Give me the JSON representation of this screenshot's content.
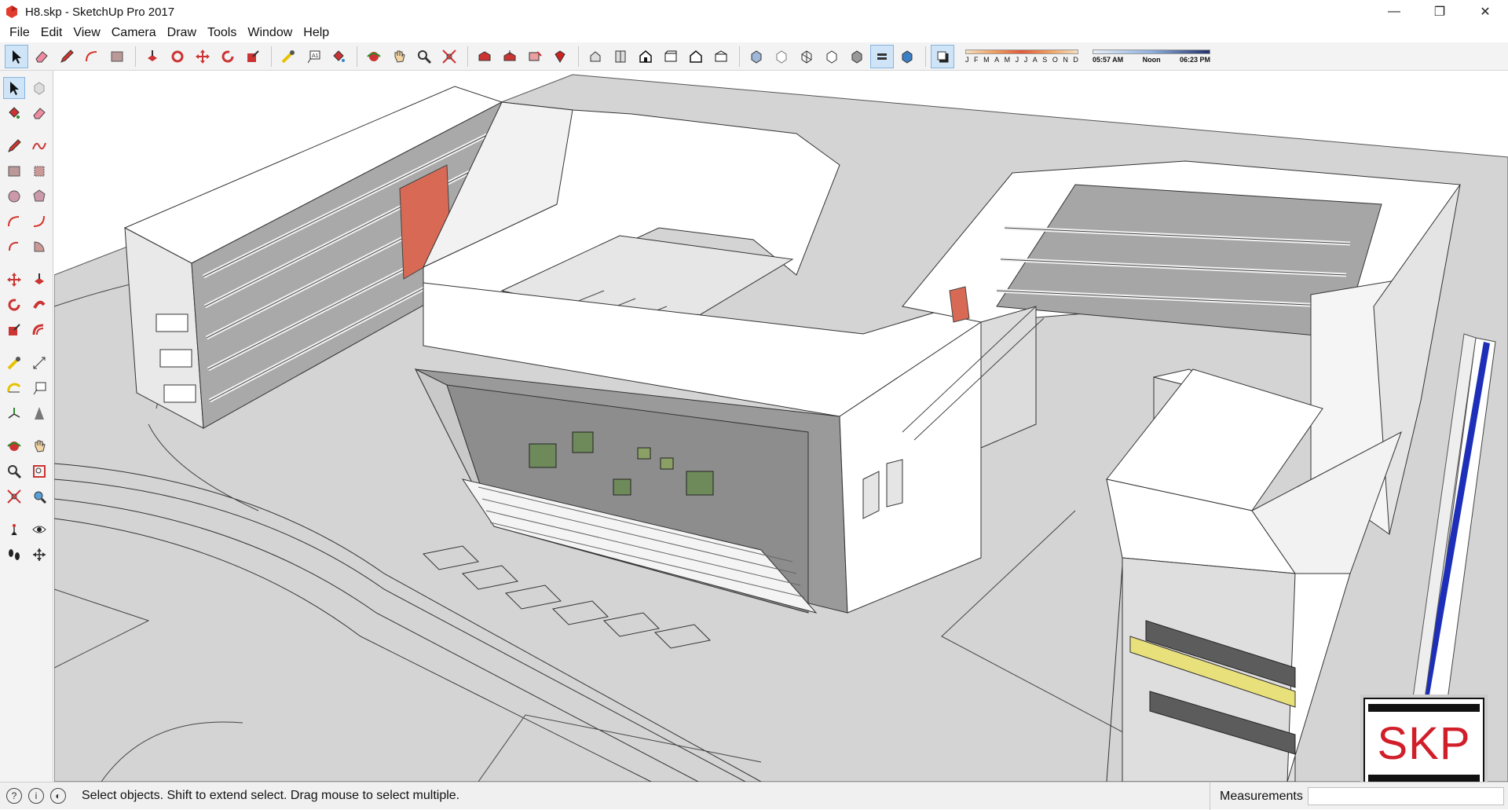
{
  "window": {
    "title": "H8.skp - SketchUp Pro 2017",
    "minimize_glyph": "—",
    "restore_glyph": "❐",
    "close_glyph": "✕"
  },
  "menu": [
    "File",
    "Edit",
    "View",
    "Camera",
    "Draw",
    "Tools",
    "Window",
    "Help"
  ],
  "shadows": {
    "months": [
      "J",
      "F",
      "M",
      "A",
      "M",
      "J",
      "J",
      "A",
      "S",
      "O",
      "N",
      "D"
    ],
    "sunrise": "05:57 AM",
    "noon": "Noon",
    "sunset": "06:23 PM"
  },
  "logo": {
    "text": "SKP"
  },
  "status": {
    "message": "Select objects. Shift to extend select. Drag mouse to select multiple.",
    "measurements_label": "Measurements",
    "measurements_value": ""
  },
  "colors": {
    "accent_blue": "#1d2fb8",
    "facade_red": "#d86a55",
    "stripe_yellow": "#e8e07a",
    "logo_red": "#d11f2a"
  }
}
